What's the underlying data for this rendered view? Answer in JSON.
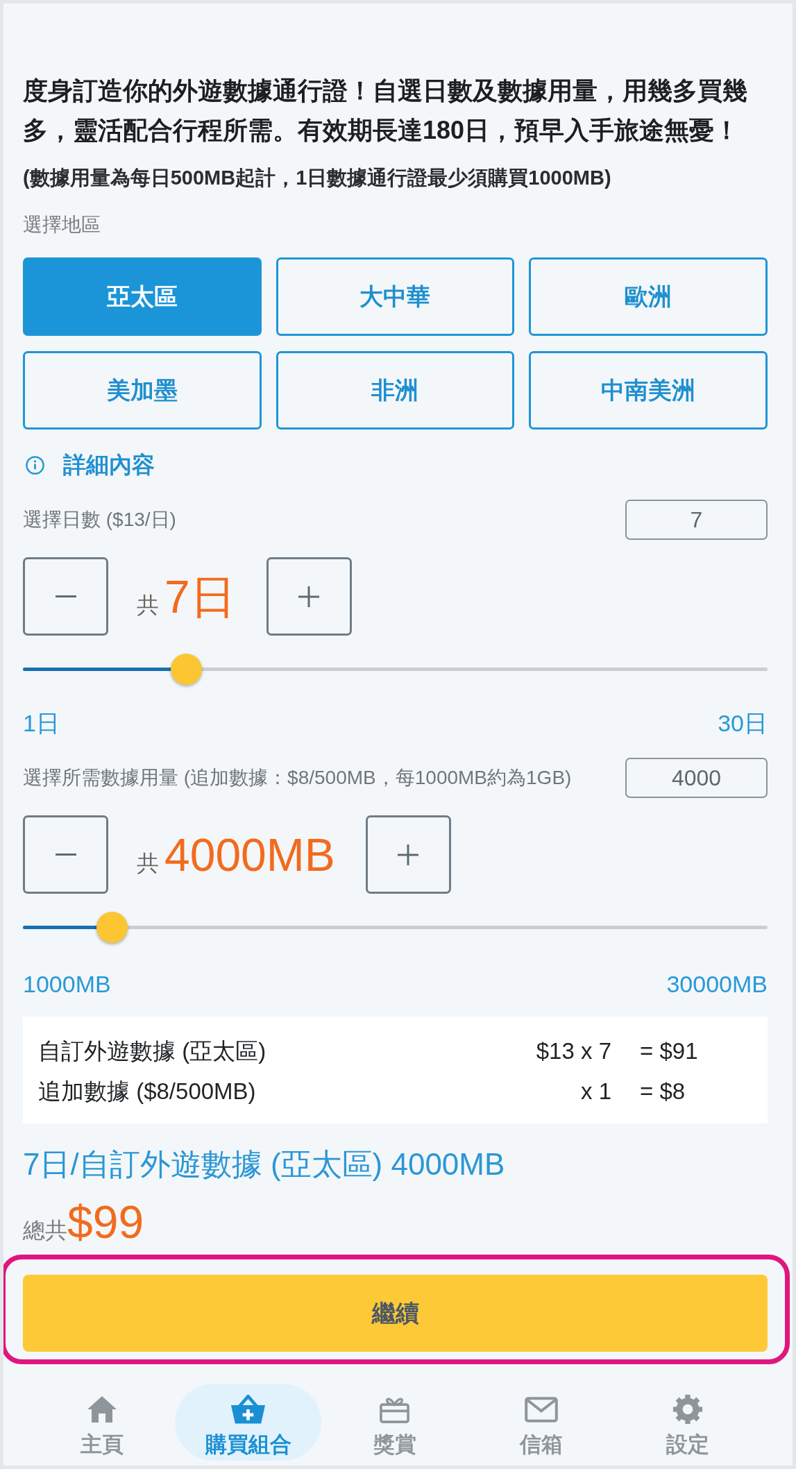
{
  "intro": {
    "text": "度身訂造你的外遊數據通行證！自選日數及數據用量，用幾多買幾多，靈活配合行程所需。有效期長達180日，預早入手旅途無憂！",
    "note": "(數據用量為每日500MB起計，1日數據通行證最少須購買1000MB)"
  },
  "region": {
    "label": "選擇地區",
    "options": [
      {
        "label": "亞太區",
        "selected": true
      },
      {
        "label": "大中華",
        "selected": false
      },
      {
        "label": "歐洲",
        "selected": false
      },
      {
        "label": "美加墨",
        "selected": false
      },
      {
        "label": "非洲",
        "selected": false
      },
      {
        "label": "中南美洲",
        "selected": false
      }
    ],
    "details_link": "詳細內容"
  },
  "days": {
    "label": "選擇日數 ($13/日)",
    "value": "7",
    "prefix": "共",
    "total": "7日",
    "level": 0.207,
    "min_label": "1日",
    "max_label": "30日"
  },
  "data": {
    "label": "選擇所需數據用量 (追加數據：$8/500MB，每1000MB約為1GB)",
    "value": "4000",
    "prefix": "共",
    "total": "4000MB",
    "level": 0.103,
    "min_label": "1000MB",
    "max_label": "30000MB"
  },
  "summary": {
    "rows": [
      {
        "label": "自訂外遊數據 (亞太區)",
        "quantity": "$13 x 7",
        "amount": "= $91"
      },
      {
        "label": "追加數據 ($8/500MB)",
        "quantity": "x 1",
        "amount": "= $8"
      }
    ]
  },
  "plan_title": "7日/自訂外遊數據 (亞太區) 4000MB",
  "total": {
    "label": "總共",
    "amount": "$99"
  },
  "continue_button": {
    "label": "繼續",
    "highlighted": true
  },
  "nav": [
    {
      "label": "主頁",
      "selected": false
    },
    {
      "label": "購買組合",
      "selected": true
    },
    {
      "label": "獎賞",
      "selected": false
    },
    {
      "label": "信箱",
      "selected": false
    },
    {
      "label": "設定",
      "selected": false
    }
  ]
}
